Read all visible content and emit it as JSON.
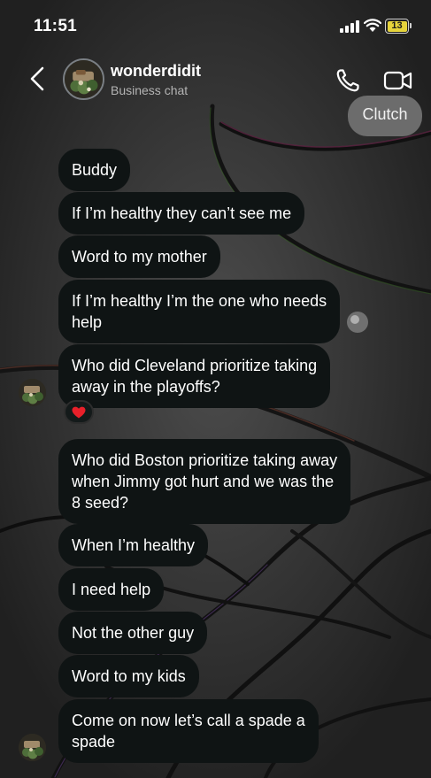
{
  "status_bar": {
    "time": "11:51",
    "battery_level": "13"
  },
  "header": {
    "contact_name": "wonderdidit",
    "subtitle": "Business chat"
  },
  "sent_messages": [
    {
      "text": "Clutch"
    }
  ],
  "received_messages": [
    {
      "text": "Buddy"
    },
    {
      "text": "If I’m healthy they can’t see me"
    },
    {
      "text": "Word to my mother"
    },
    {
      "text": "If I’m healthy I’m the one who needs\nhelp"
    },
    {
      "text": "Who did Cleveland prioritize taking\naway in the playoffs?",
      "reaction": "heart"
    },
    {
      "text": "Who did Boston prioritize taking away\nwhen Jimmy got hurt and we was the\n8 seed?"
    },
    {
      "text": "When I’m healthy"
    },
    {
      "text": "I need help"
    },
    {
      "text": "Not the other guy"
    },
    {
      "text": "Word to my kids"
    },
    {
      "text": "Come on now let’s call a spade a\nspade"
    }
  ],
  "icons": {
    "back": "chevron-left-icon",
    "call": "phone-icon",
    "video": "video-camera-icon",
    "reaction": "red-heart-icon"
  },
  "colors": {
    "received_bubble": "#0f1414",
    "sent_bubble": "#6c6c6c",
    "battery": "#e5d33b",
    "reaction_heart": "#e8202a"
  }
}
